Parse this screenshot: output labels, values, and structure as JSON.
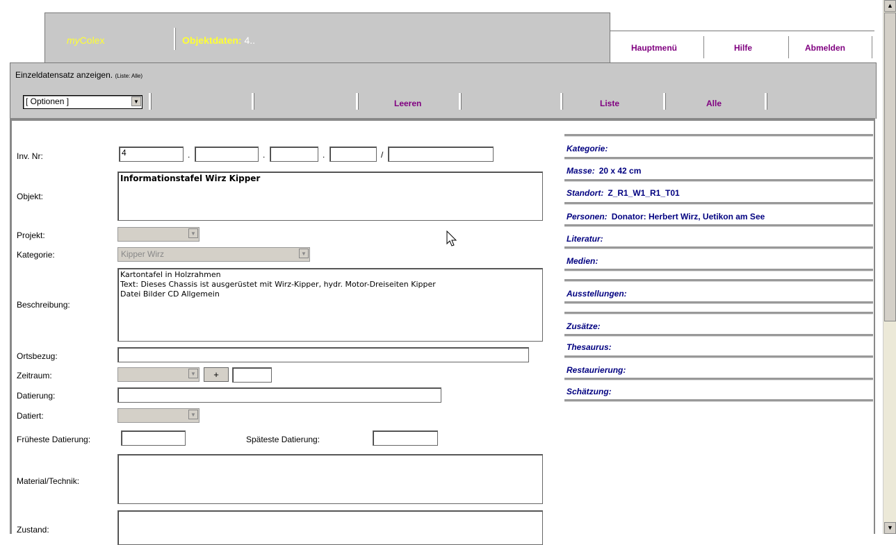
{
  "header": {
    "logo_prefix": "my",
    "logo_suffix": "Colex",
    "object_label": "Objektdaten:",
    "object_number": "4..",
    "links": {
      "main_menu": "Hauptmenü",
      "help": "Hilfe",
      "logout": "Abmelden"
    }
  },
  "toolbar": {
    "title": "Einzeldatensatz anzeigen.",
    "title_hint": "(Liste: Alle)",
    "options_select": "[ Optionen ]",
    "clear": "Leeren",
    "list": "Liste",
    "all": "Alle"
  },
  "form": {
    "inv_nr_label": "Inv. Nr:",
    "inv_nr_values": [
      "4",
      "",
      "",
      "",
      ""
    ],
    "inv_nr_separators": [
      ".",
      ".",
      ".",
      "/"
    ],
    "objekt_label": "Objekt:",
    "objekt_value": "Informationstafel Wirz Kipper",
    "projekt_label": "Projekt:",
    "projekt_value": "",
    "kategorie_label": "Kategorie:",
    "kategorie_value": "Kipper Wirz",
    "beschreibung_label": "Beschreibung:",
    "beschreibung_value": "Kartontafel in Holzrahmen\nText: Dieses Chassis ist ausgerüstet mit Wirz-Kipper, hydr. Motor-Dreiseiten Kipper\nDatei Bilder CD Allgemein",
    "ortsbezug_label": "Ortsbezug:",
    "ortsbezug_value": "",
    "zeitraum_label": "Zeitraum:",
    "zeitraum_plus": "+",
    "zeitraum_value": "",
    "datierung_label": "Datierung:",
    "datierung_value": "",
    "datiert_label": "Datiert:",
    "frueheste_label": "Früheste Datierung:",
    "frueheste_value": "",
    "spaeteste_label": "Späteste Datierung:",
    "spaeteste_value": "",
    "material_label": "Material/Technik:",
    "material_value": "",
    "zustand_label": "Zustand:",
    "zustand_value": ""
  },
  "info": {
    "kategorie": {
      "label": "Kategorie:",
      "value": ""
    },
    "masse": {
      "label": "Masse:",
      "value": "20 x 42 cm"
    },
    "standort": {
      "label": "Standort:",
      "value": "Z_R1_W1_R1_T01"
    },
    "personen": {
      "label": "Personen:",
      "value": "Donator: Herbert Wirz, Uetikon am See"
    },
    "literatur": {
      "label": "Literatur:",
      "value": ""
    },
    "medien": {
      "label": "Medien:",
      "value": ""
    },
    "ausstellungen": {
      "label": "Ausstellungen:",
      "value": ""
    },
    "zusaetze": {
      "label": "Zusätze:",
      "value": ""
    },
    "thesaurus": {
      "label": "Thesaurus:",
      "value": ""
    },
    "restaurierung": {
      "label": "Restaurierung:",
      "value": ""
    },
    "schaetzung": {
      "label": "Schätzung:",
      "value": ""
    }
  },
  "icons": {
    "dropdown": "chevron-down-icon",
    "scroll_up": "arrow-up-icon",
    "scroll_down": "arrow-down-icon",
    "cursor": "mouse-pointer-icon"
  }
}
